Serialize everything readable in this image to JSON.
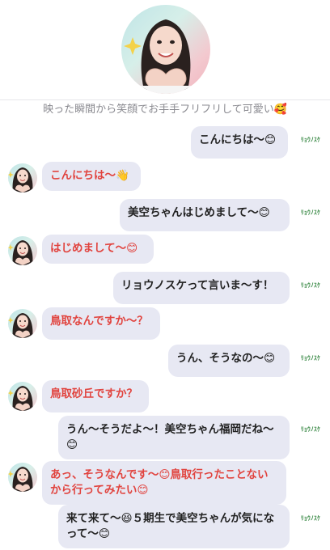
{
  "caption": "映った瞬間から笑顔でお手手フリフリして可愛い🥰",
  "sender_tag": "ﾘｮｳﾉｽｹ",
  "messages": [
    {
      "side": "right",
      "text": "こんにちは〜😊"
    },
    {
      "side": "left",
      "text": "こんにちは〜👋"
    },
    {
      "side": "right",
      "text": "美空ちゃんはじめまして〜😊"
    },
    {
      "side": "left",
      "text": "はじめまして〜😊"
    },
    {
      "side": "right",
      "text": "リョウノスケって言いま〜す！"
    },
    {
      "side": "left",
      "text": "鳥取なんですか〜？"
    },
    {
      "side": "right",
      "text": "うん、そうなの〜😊"
    },
    {
      "side": "left",
      "text": "鳥取砂丘ですか？"
    },
    {
      "side": "right",
      "text": "うん〜そうだよ〜！美空ちゃん福岡だね〜😊"
    },
    {
      "side": "left",
      "text": "あっ、そうなんです〜😊鳥取行ったことないから行ってみたい😊"
    },
    {
      "side": "right",
      "text": "来て来て〜😆５期生で美空ちゃんが気になって〜😊"
    }
  ],
  "colors": {
    "bubble_bg": "#e7e8f3",
    "left_text": "#e1443f",
    "right_text": "#222222",
    "tag_green": "#3e8c4a"
  }
}
